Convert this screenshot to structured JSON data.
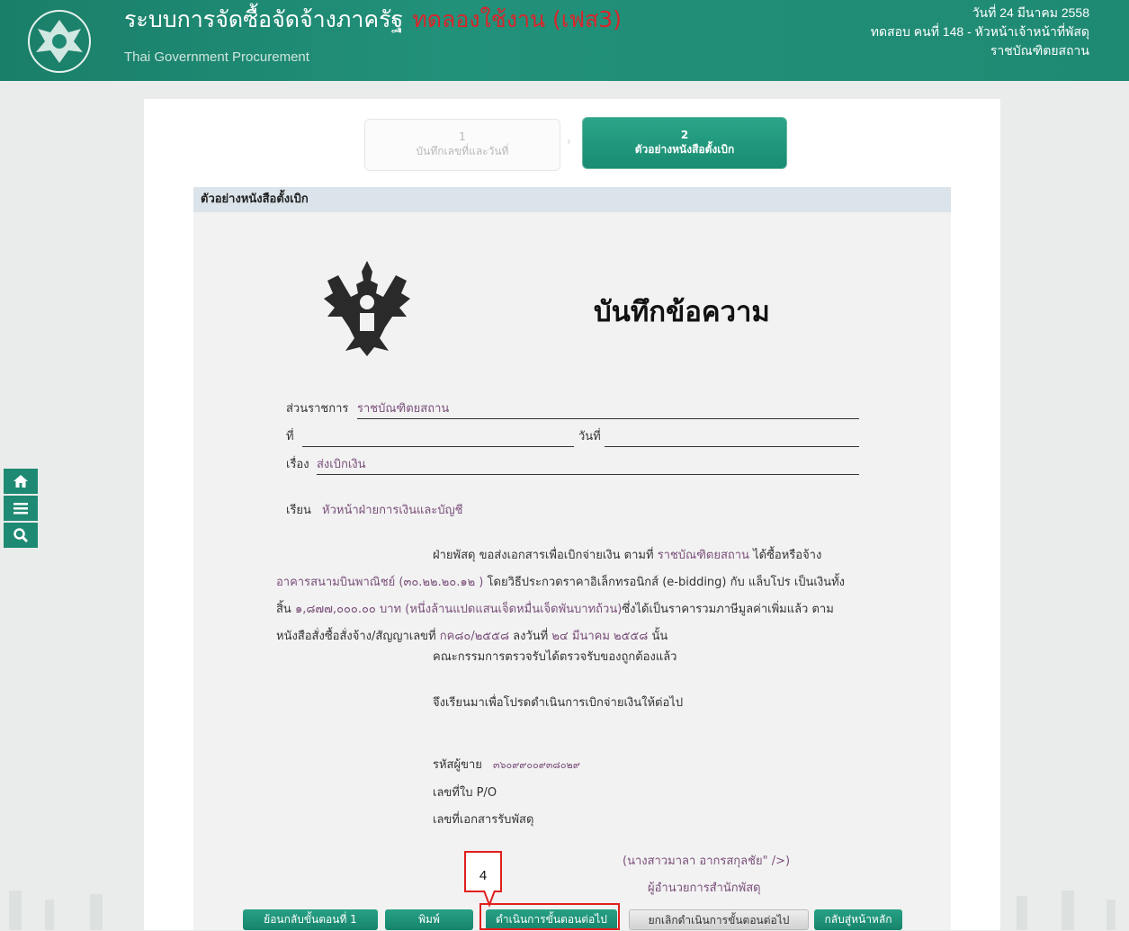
{
  "header": {
    "title": "ระบบการจัดซื้อจัดจ้างภาครัฐ",
    "phase": "ทดลองใช้งาน (เฟส3)",
    "subtitle": "Thai Government Procurement",
    "date": "วันที่ 24 มีนาคม 2558",
    "user": "ทดสอบ คนที่ 148 - หัวหน้าเจ้าหน้าที่พัสดุ",
    "org": "ราชบัณฑิตยสถาน"
  },
  "sidebar": {
    "home_icon": "home-icon",
    "menu_icon": "menu-icon",
    "search_icon": "search-icon"
  },
  "steps": [
    {
      "num": "1",
      "label": "บันทึกเลขที่และวันที่"
    },
    {
      "num": "2",
      "label": "ตัวอย่างหนังสือตั้งเบิก"
    }
  ],
  "section_title": "ตัวอย่างหนังสือตั้งเบิก",
  "doc": {
    "title": "บันทึกข้อความ",
    "agency_label": "ส่วนราชการ",
    "agency_value": "ราชบัณฑิตยสถาน",
    "no_label": "ที่",
    "date_label": "วันที่",
    "subject_label": "เรื่อง",
    "subject_value": "ส่งเบิกเงิน",
    "to_label": "เรียน",
    "to_value": "หัวหน้าฝ่ายการเงินและบัญชี",
    "p1_a": "ฝ่ายพัสดุ ขอส่งเอกสารเพื่อเบิกจ่ายเงิน ตามที่",
    "p1_b": "ราชบัณฑิตยสถาน",
    "p1_c": "ได้ซื้อหรือจ้าง",
    "p2_a": "อาคารสนามบินพาณิชย์ (๓๐.๒๒.๒๐.๑๒ )",
    "p2_b": "โดยวิธีประกวดราคาอิเล็กทรอนิกส์ (e-bidding) กับ แล็บโปร เป็นเงินทั้ง",
    "p3_a": "สิ้น",
    "p3_b": "๑,๘๗๗,๐๐๐.๐๐ บาท (หนึ่งล้านแปดแสนเจ็ดหมื่นเจ็ดพันบาทถ้วน)",
    "p3_c": "ซึ่งได้เป็นราคารวมภาษีมูลค่าเพิ่มแล้ว ตาม",
    "p4_a": "หนังสือสั่งซื้อสั่งจ้าง/สัญญาเลขที่",
    "p4_b": "กค๘๐/๒๕๕๘",
    "p4_c": "ลงวันที่",
    "p4_d": "๒๔ มีนาคม ๒๕๕๘",
    "p4_e": "นั้น",
    "p5": "คณะกรรมการตรวจรับได้ตรวจรับของถูกต้องแล้ว",
    "p6": "จึงเรียนมาเพื่อโปรดดำเนินการเบิกจ่ายเงินให้ต่อไป",
    "vendor_label": "รหัสผู้ขาย",
    "vendor_value": "๓๖๐๙๙๐๐๙๓๘๐๒๙",
    "po_label": "เลขที่ใบ P/O",
    "receipt_label": "เลขที่เอกสารรับพัสดุ",
    "signer": "(นางสาวมาลา อากรสกุลชัย\" />)",
    "signer_title": "ผู้อำนวยการสำนักพัสดุ"
  },
  "buttons": {
    "back": "ย้อนกลับขั้นตอนที่ 1",
    "print": "พิมพ์",
    "next": "ดำเนินการขั้นตอนต่อไป",
    "cancel": "ยกเลิกดำเนินการขั้นตอนต่อไป",
    "home": "กลับสู่หน้าหลัก"
  },
  "callout_number": "4",
  "colors": {
    "primary": "#1f8a73",
    "highlight": "#e0201c",
    "phase": "#d8262b",
    "value_text": "#7a4f7a"
  }
}
